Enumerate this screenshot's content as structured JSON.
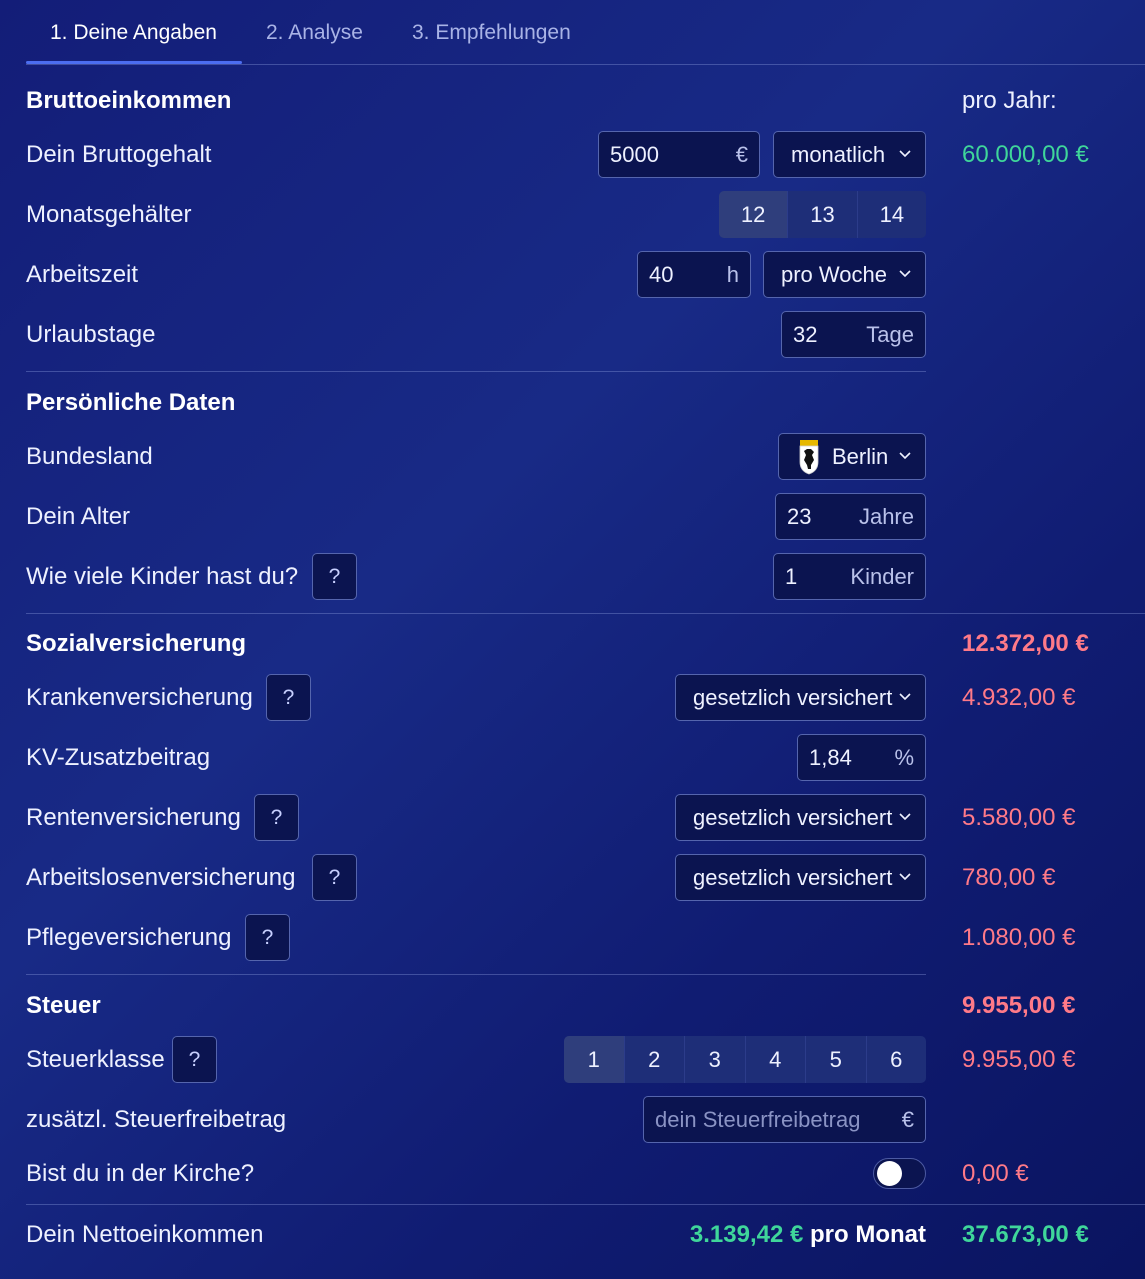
{
  "tabs": [
    {
      "label": "1. Deine Angaben"
    },
    {
      "label": "2. Analyse"
    },
    {
      "label": "3. Empfehlungen"
    }
  ],
  "income": {
    "title": "Bruttoeinkommen",
    "per_year_label": "pro Jahr:",
    "gross_label": "Dein Bruttogehalt",
    "gross_value": "5000",
    "gross_unit": "€",
    "period_select": "monatlich",
    "gross_per_year": "60.000,00 €",
    "salaries_label": "Monatsgehälter",
    "salaries_options": [
      "12",
      "13",
      "14"
    ],
    "salaries_selected": "12",
    "worktime_label": "Arbeitszeit",
    "worktime_value": "40",
    "worktime_unit": "h",
    "worktime_period": "pro Woche",
    "vacation_label": "Urlaubstage",
    "vacation_value": "32",
    "vacation_unit": "Tage"
  },
  "personal": {
    "title": "Persönliche Daten",
    "state_label": "Bundesland",
    "state_value": "Berlin",
    "age_label": "Dein Alter",
    "age_value": "23",
    "age_unit": "Jahre",
    "kids_label": "Wie viele Kinder hast du?",
    "kids_value": "1",
    "kids_unit": "Kinder"
  },
  "social": {
    "title": "Sozialversicherung",
    "total": "12.372,00 €",
    "health_label": "Krankenversicherung",
    "health_select": "gesetzlich versichert",
    "health_amount": "4.932,00 €",
    "kv_label": "KV-Zusatzbeitrag",
    "kv_value": "1,84",
    "kv_unit": "%",
    "pension_label": "Rentenversicherung",
    "pension_select": "gesetzlich versichert",
    "pension_amount": "5.580,00 €",
    "unemployment_label": "Arbeitslosenversicherung",
    "unemployment_select": "gesetzlich versichert",
    "unemployment_amount": "780,00 €",
    "care_label": "Pflegeversicherung",
    "care_amount": "1.080,00 €"
  },
  "tax": {
    "title": "Steuer",
    "total": "9.955,00 €",
    "class_label": "Steuerklasse",
    "class_options": [
      "1",
      "2",
      "3",
      "4",
      "5",
      "6"
    ],
    "class_selected": "1",
    "class_amount": "9.955,00 €",
    "allowance_label": "zusätzl. Steuerfreibetrag",
    "allowance_placeholder": "dein Steuerfreibetrag",
    "allowance_unit": "€",
    "church_label": "Bist du in der Kirche?",
    "church_amount": "0,00 €"
  },
  "net": {
    "label": "Dein Nettoeinkommen",
    "monthly": "3.139,42 €",
    "monthly_suffix": "pro Monat",
    "yearly": "37.673,00 €"
  },
  "help_symbol": "?"
}
